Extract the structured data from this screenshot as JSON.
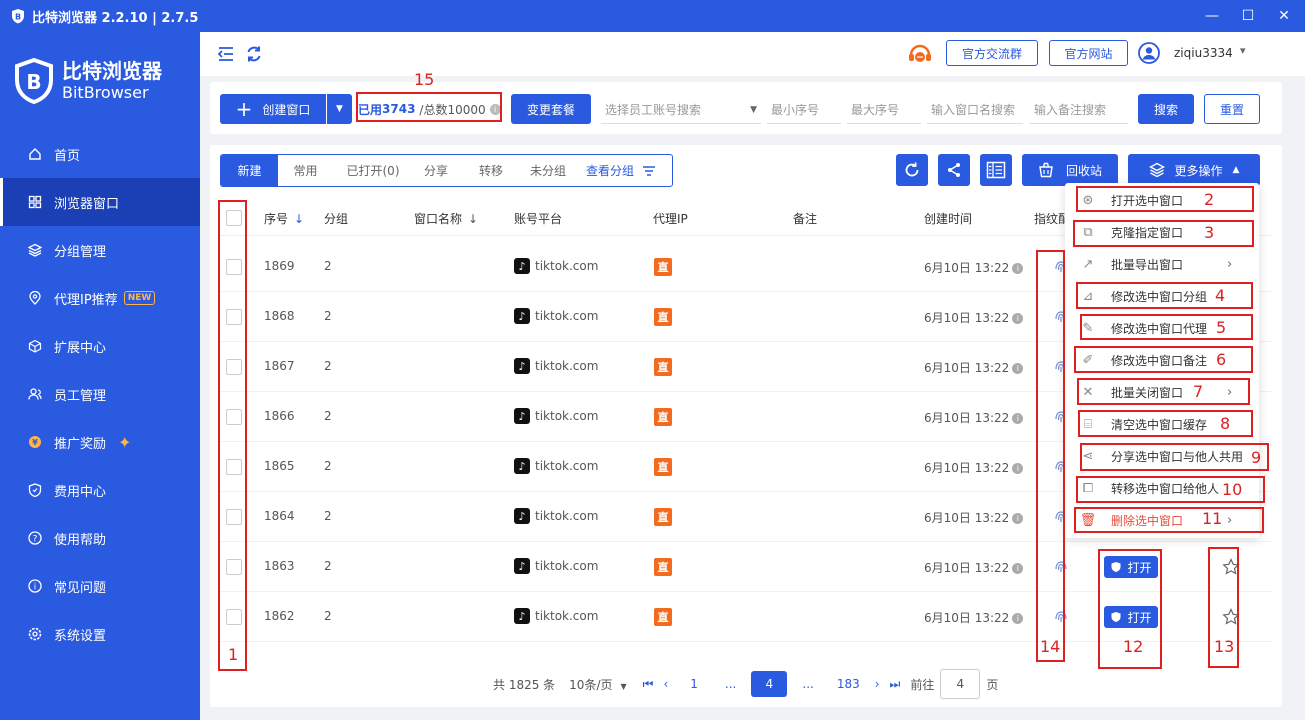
{
  "window": {
    "title": "比特浏览器 2.2.10 | 2.7.5"
  },
  "brand": {
    "name_cn": "比特浏览器",
    "name_en": "BitBrowser"
  },
  "sidebar": {
    "items": [
      {
        "label": "首页",
        "icon": "home-icon"
      },
      {
        "label": "浏览器窗口",
        "icon": "grid-icon",
        "active": true
      },
      {
        "label": "分组管理",
        "icon": "layers-icon"
      },
      {
        "label": "代理IP推荐",
        "icon": "location-icon",
        "badge": "NEW"
      },
      {
        "label": "扩展中心",
        "icon": "cube-icon"
      },
      {
        "label": "员工管理",
        "icon": "users-icon"
      },
      {
        "label": "推广奖励",
        "icon": "reward-icon"
      },
      {
        "label": "费用中心",
        "icon": "shield-icon"
      },
      {
        "label": "使用帮助",
        "icon": "help-icon"
      },
      {
        "label": "常见问题",
        "icon": "info-icon"
      },
      {
        "label": "系统设置",
        "icon": "settings-icon"
      }
    ]
  },
  "header": {
    "community_btn": "官方交流群",
    "website_btn": "官方网站",
    "username": "ziqiu3334"
  },
  "toolbar": {
    "create_btn": "创建窗口",
    "quota_used_prefix": "已用",
    "quota_used_value": "3743",
    "quota_total": "/总数10000",
    "change_plan_btn": "变更套餐",
    "staff_placeholder": "选择员工账号搜索",
    "min_seq_placeholder": "最小序号",
    "max_seq_placeholder": "最大序号",
    "window_name_placeholder": "输入窗口名搜索",
    "remark_placeholder": "输入备注搜索",
    "search_btn": "搜索",
    "reset_btn": "重置"
  },
  "tabs": {
    "new": "新建",
    "common": "常用",
    "opened": "已打开(0)",
    "share": "分享",
    "transfer": "转移",
    "ungrouped": "未分组",
    "view_groups": "查看分组"
  },
  "actions": {
    "recycle_bin": "回收站",
    "more_ops": "更多操作"
  },
  "table": {
    "headers": {
      "seq": "序号",
      "group": "分组",
      "name": "窗口名称",
      "platform": "账号平台",
      "proxy": "代理IP",
      "remark": "备注",
      "created": "创建时间",
      "fingerprint": "指纹配"
    },
    "rows": [
      {
        "seq": "1869",
        "group": "2",
        "platform": "tiktok.com",
        "proxy": "直",
        "created": "6月10日 13:22"
      },
      {
        "seq": "1868",
        "group": "2",
        "platform": "tiktok.com",
        "proxy": "直",
        "created": "6月10日 13:22"
      },
      {
        "seq": "1867",
        "group": "2",
        "platform": "tiktok.com",
        "proxy": "直",
        "created": "6月10日 13:22"
      },
      {
        "seq": "1866",
        "group": "2",
        "platform": "tiktok.com",
        "proxy": "直",
        "created": "6月10日 13:22"
      },
      {
        "seq": "1865",
        "group": "2",
        "platform": "tiktok.com",
        "proxy": "直",
        "created": "6月10日 13:22"
      },
      {
        "seq": "1864",
        "group": "2",
        "platform": "tiktok.com",
        "proxy": "直",
        "created": "6月10日 13:22"
      },
      {
        "seq": "1863",
        "group": "2",
        "platform": "tiktok.com",
        "proxy": "直",
        "created": "6月10日 13:22",
        "open": "打开"
      },
      {
        "seq": "1862",
        "group": "2",
        "platform": "tiktok.com",
        "proxy": "直",
        "created": "6月10日 13:22",
        "open": "打开"
      }
    ]
  },
  "pagination": {
    "total": "共 1825 条",
    "page_size": "10条/页",
    "first": "1",
    "ellipsis": "...",
    "current": "4",
    "last": "183",
    "goto_label": "前往",
    "goto_value": "4",
    "page_suffix": "页"
  },
  "dropdown": {
    "items": [
      {
        "label": "打开选中窗口",
        "icon": "open-window-icon"
      },
      {
        "label": "克隆指定窗口",
        "icon": "clone-icon"
      },
      {
        "label": "批量导出窗口",
        "icon": "export-icon",
        "submenu": true
      },
      {
        "label": "修改选中窗口分组",
        "icon": "edit-group-icon"
      },
      {
        "label": "修改选中窗口代理",
        "icon": "edit-proxy-icon"
      },
      {
        "label": "修改选中窗口备注",
        "icon": "edit-remark-icon"
      },
      {
        "label": "批量关闭窗口",
        "icon": "close-icon",
        "submenu": true
      },
      {
        "label": "清空选中窗口缓存",
        "icon": "broom-icon"
      },
      {
        "label": "分享选中窗口与他人共用",
        "icon": "share-icon"
      },
      {
        "label": "转移选中窗口给他人",
        "icon": "transfer-icon"
      },
      {
        "label": "删除选中窗口",
        "icon": "trash-icon",
        "submenu": true,
        "danger": true
      }
    ]
  },
  "annotations": [
    "1",
    "2",
    "3",
    "4",
    "5",
    "6",
    "7",
    "8",
    "9",
    "10",
    "11",
    "12",
    "13",
    "14",
    "15"
  ],
  "colors": {
    "primary": "#2a5ae0",
    "danger": "#e74c3c",
    "annotation": "#e02020",
    "proxy_badge": "#f26b1f"
  }
}
